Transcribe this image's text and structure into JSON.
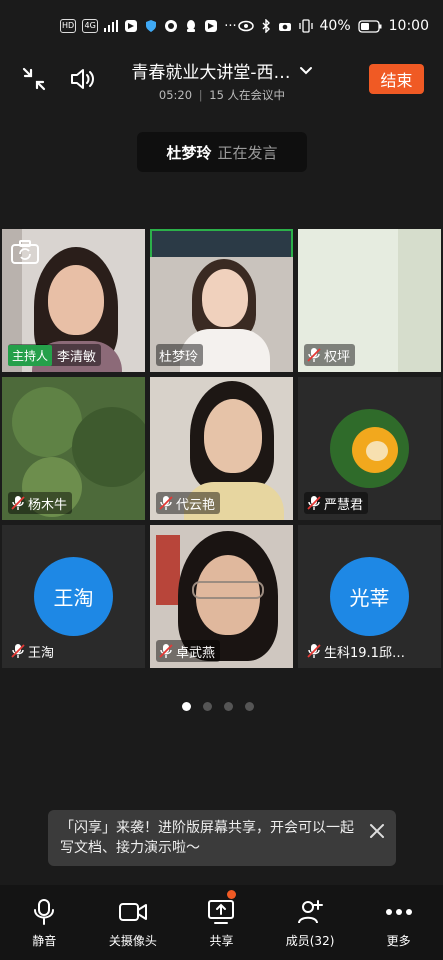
{
  "status_bar": {
    "left_chips": [
      "HD",
      "4G"
    ],
    "battery": "40%",
    "time": "10:00"
  },
  "header": {
    "title": "青春就业大讲堂-西…",
    "duration": "05:20",
    "separator": "|",
    "participants": "15 人在会议中",
    "end_button": "结束"
  },
  "speaking": {
    "name": "杜梦玲",
    "status": "正在发言"
  },
  "tiles": [
    {
      "name": "李清敏",
      "host_tag": "主持人"
    },
    {
      "name": "杜梦玲"
    },
    {
      "name": "权坪"
    },
    {
      "name": "杨木牛"
    },
    {
      "name": "代云艳"
    },
    {
      "name": "严慧君"
    },
    {
      "name": "王淘",
      "avatar_text": "王淘"
    },
    {
      "name": "卓武燕"
    },
    {
      "name": "生科19.1邱…",
      "avatar_text": "光莘"
    }
  ],
  "pager": {
    "pages": 4,
    "current": 1
  },
  "toast": {
    "text": "「闪享」来袭！进阶版屏幕共享，开会可以一起写文档、接力演示啦～"
  },
  "bottom_bar": [
    {
      "label": "静音",
      "icon": "microphone-icon"
    },
    {
      "label": "关摄像头",
      "icon": "video-camera-icon"
    },
    {
      "label": "共享",
      "icon": "screen-share-icon"
    },
    {
      "label": "成员(32)",
      "icon": "add-member-icon"
    },
    {
      "label": "更多",
      "icon": "more-dots-icon"
    }
  ],
  "colors": {
    "accent_end": "#f05a24",
    "host_tag": "#25a04a",
    "active_border": "#2cb04a",
    "avatar_blue": "#1e88e5"
  }
}
